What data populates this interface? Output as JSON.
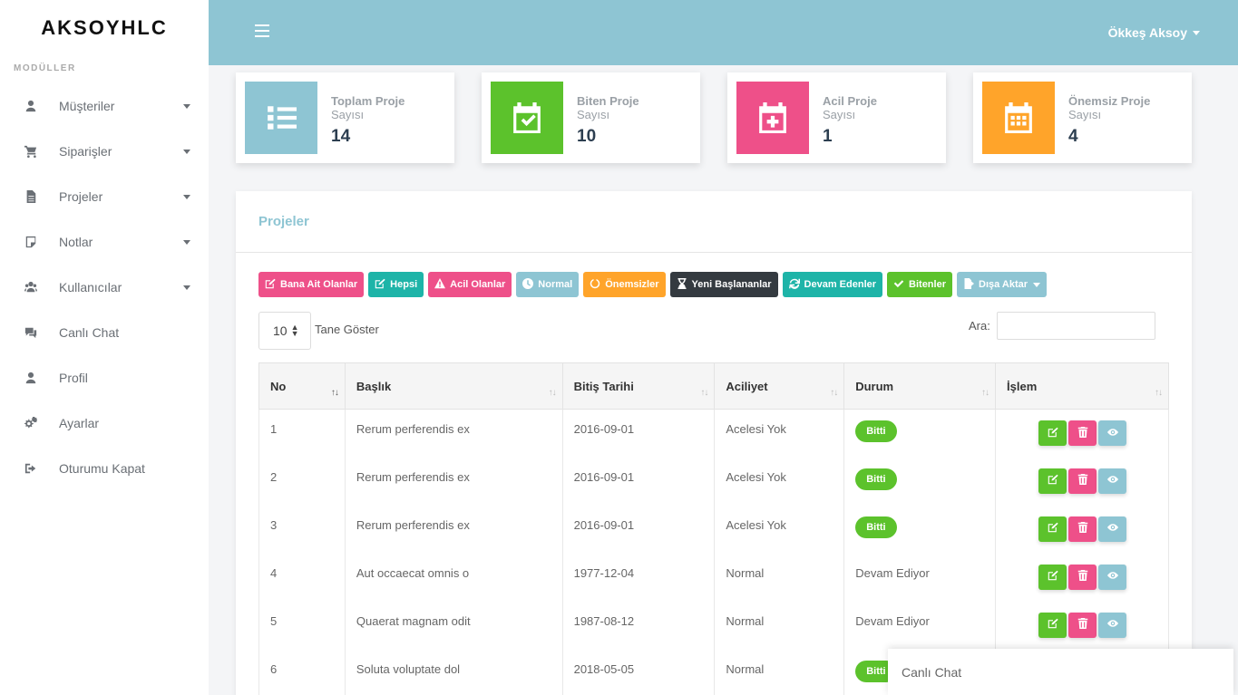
{
  "brand": "AKSOYHLC",
  "sidebar": {
    "section_title": "MODÜLLER",
    "items": [
      {
        "label": "Müşteriler",
        "icon": "user-icon",
        "has_caret": true
      },
      {
        "label": "Siparişler",
        "icon": "cart-icon",
        "has_caret": true
      },
      {
        "label": "Projeler",
        "icon": "file-icon",
        "has_caret": true
      },
      {
        "label": "Notlar",
        "icon": "note-icon",
        "has_caret": true
      },
      {
        "label": "Kullanıcılar",
        "icon": "users-icon",
        "has_caret": true
      },
      {
        "label": "Canlı Chat",
        "icon": "chat-icon",
        "has_caret": false
      },
      {
        "label": "Profil",
        "icon": "profile-icon",
        "has_caret": false
      },
      {
        "label": "Ayarlar",
        "icon": "gears-icon",
        "has_caret": false
      },
      {
        "label": "Oturumu Kapat",
        "icon": "logout-icon",
        "has_caret": false
      }
    ]
  },
  "topbar": {
    "user_name": "Ökkeş Aksoy"
  },
  "stats": [
    {
      "title": "Toplam Proje",
      "subtitle": "Sayısı",
      "value": "14",
      "color": "#8ec5d3",
      "icon": "list-icon"
    },
    {
      "title": "Biten Proje",
      "subtitle": "Sayısı",
      "value": "10",
      "color": "#5cc22c",
      "icon": "calendar-check-icon"
    },
    {
      "title": "Acil Proje",
      "subtitle": "Sayısı",
      "value": "1",
      "color": "#ee5089",
      "icon": "calendar-plus-icon"
    },
    {
      "title": "Önemsiz Proje",
      "subtitle": "Sayısı",
      "value": "4",
      "color": "#ffa42a",
      "icon": "calendar-grid-icon"
    }
  ],
  "panel": {
    "title": "Projeler"
  },
  "filters": [
    {
      "label": "Bana Ait Olanlar",
      "color": "#ee5089",
      "icon": "edit-icon"
    },
    {
      "label": "Hepsi",
      "color": "#1eb4a8",
      "icon": "edit-icon"
    },
    {
      "label": "Acil Olanlar",
      "color": "#ee5089",
      "icon": "warning-icon"
    },
    {
      "label": "Normal",
      "color": "#8ec5d3",
      "icon": "clock-icon"
    },
    {
      "label": "Önemsizler",
      "color": "#ffa42a",
      "icon": "circle-notch-icon"
    },
    {
      "label": "Yeni Başlananlar",
      "color": "#343a40",
      "icon": "hourglass-icon"
    },
    {
      "label": "Devam Edenler",
      "color": "#1eb4a8",
      "icon": "sync-icon"
    },
    {
      "label": "Bitenler",
      "color": "#5cc22c",
      "icon": "check-icon"
    },
    {
      "label": "Dışa Aktar",
      "color": "#8ec5d3",
      "icon": "export-icon"
    }
  ],
  "table_controls": {
    "page_length": "10",
    "length_label": "Tane Göster",
    "search_label": "Ara:",
    "search_value": ""
  },
  "table": {
    "headers": [
      "No",
      "Başlık",
      "Bitiş Tarihi",
      "Aciliyet",
      "Durum",
      "İşlem"
    ],
    "rows": [
      {
        "no": "1",
        "title": "Rerum perferendis ex",
        "date": "2016-09-01",
        "urgency": "Acelesi Yok",
        "status": "Bitti",
        "status_badge": true
      },
      {
        "no": "2",
        "title": "Rerum perferendis ex",
        "date": "2016-09-01",
        "urgency": "Acelesi Yok",
        "status": "Bitti",
        "status_badge": true
      },
      {
        "no": "3",
        "title": "Rerum perferendis ex",
        "date": "2016-09-01",
        "urgency": "Acelesi Yok",
        "status": "Bitti",
        "status_badge": true
      },
      {
        "no": "4",
        "title": "Aut occaecat omnis o",
        "date": "1977-12-04",
        "urgency": "Normal",
        "status": "Devam Ediyor",
        "status_badge": false
      },
      {
        "no": "5",
        "title": "Quaerat magnam odit",
        "date": "1987-08-12",
        "urgency": "Normal",
        "status": "Devam Ediyor",
        "status_badge": false
      },
      {
        "no": "6",
        "title": "Soluta voluptate dol",
        "date": "2018-05-05",
        "urgency": "Normal",
        "status": "Bitti",
        "status_badge": true
      }
    ],
    "action_colors": {
      "edit": "#5cc22c",
      "delete": "#ee5089",
      "view": "#8ec5d3"
    }
  },
  "chat": {
    "label": "Canlı Chat"
  }
}
